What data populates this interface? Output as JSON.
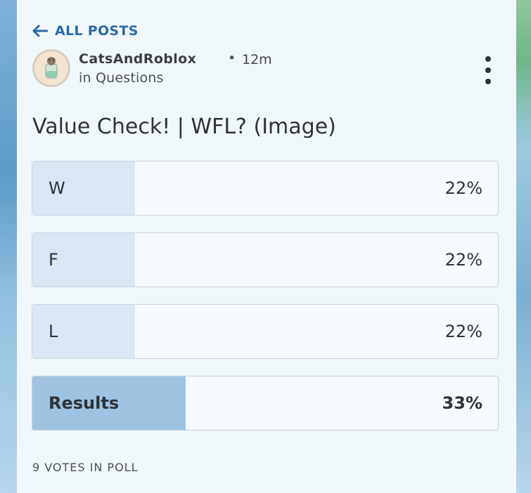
{
  "nav": {
    "back_label": "ALL POSTS",
    "back_icon": "arrow-left-icon"
  },
  "post": {
    "author": "CatsAndRoblox",
    "separator": "•",
    "time": "12m",
    "category": "in Questions",
    "title": "Value Check! | WFL? (Image)",
    "more_icon": "more-vertical-icon"
  },
  "poll": {
    "options": [
      {
        "label": "W",
        "percent_text": "22%",
        "percent": 22
      },
      {
        "label": "F",
        "percent_text": "22%",
        "percent": 22
      },
      {
        "label": "L",
        "percent_text": "22%",
        "percent": 22
      }
    ],
    "results": {
      "label": "Results",
      "percent_text": "33%",
      "percent": 33
    },
    "votes_text": "9 VOTES IN POLL"
  },
  "colors": {
    "accent": "#2b6aa8",
    "option_fill": "#d8e7f3",
    "results_fill": "#9ec3e2",
    "card_bg": "#f1f8fc"
  }
}
